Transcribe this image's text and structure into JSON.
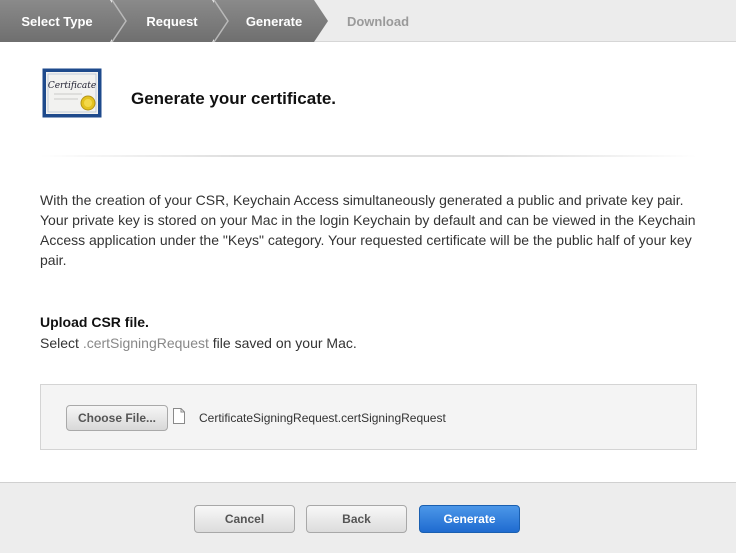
{
  "steps": [
    {
      "label": "Select Type",
      "state": "done"
    },
    {
      "label": "Request",
      "state": "done"
    },
    {
      "label": "Generate",
      "state": "current"
    },
    {
      "label": "Download",
      "state": "pending"
    }
  ],
  "header": {
    "title": "Generate your certificate.",
    "icon": "certificate-icon",
    "icon_text": "Certificate"
  },
  "description": "With the creation of your CSR, Keychain Access simultaneously generated a public and private key pair. Your private key is stored on your Mac in the login Keychain by default and can be viewed in the Keychain Access application under the \"Keys\" category. Your requested certificate will be the public half of your key pair.",
  "upload": {
    "heading": "Upload CSR file.",
    "sub_prefix": "Select",
    "sub_ext": ".certSigningRequest",
    "sub_suffix": "file saved on your Mac.",
    "choose_label": "Choose File...",
    "file_icon": "document-icon",
    "file_name": "CertificateSigningRequest.certSigningRequest"
  },
  "footer": {
    "cancel_label": "Cancel",
    "back_label": "Back",
    "generate_label": "Generate"
  },
  "colors": {
    "step_done": "#7d7d7d",
    "primary_button": "#2f7fdc",
    "footer_bg": "#ededed"
  }
}
